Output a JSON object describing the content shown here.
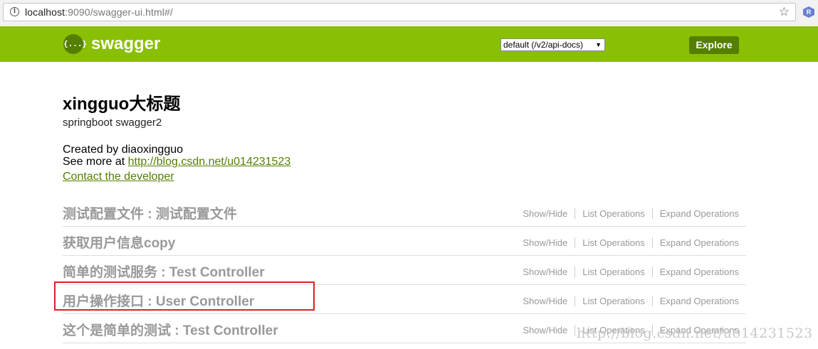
{
  "browser": {
    "url_host": "localhost",
    "url_rest": ":9090/swagger-ui.html#/",
    "info_icon": "info-icon",
    "star_icon": "star-icon",
    "extension_letter": "R"
  },
  "header": {
    "logo_glyph": "{...}",
    "logo_text": "swagger",
    "api_select_value": "default (/v2/api-docs)",
    "explore_label": "Explore",
    "colors": {
      "bar": "#89bf04",
      "button": "#547f00"
    }
  },
  "info": {
    "title": "xingguo大标题",
    "description": "springboot swagger2",
    "created_by": "Created by diaoxingguo",
    "see_more_prefix": "See more at ",
    "see_more_link": "http://blog.csdn.net/u014231523",
    "contact": "Contact the developer"
  },
  "operations_labels": {
    "show_hide": "Show/Hide",
    "list": "List Operations",
    "expand": "Expand Operations"
  },
  "resources": [
    {
      "name": "测试配置文件 : 测试配置文件"
    },
    {
      "name": "获取用户信息copy"
    },
    {
      "name": "简单的测试服务 : Test Controller"
    },
    {
      "name": "用户操作接口 : User Controller"
    },
    {
      "name": "这个是简单的测试 : Test Controller"
    }
  ],
  "watermark": "http://blog.csdn.net/u014231523"
}
